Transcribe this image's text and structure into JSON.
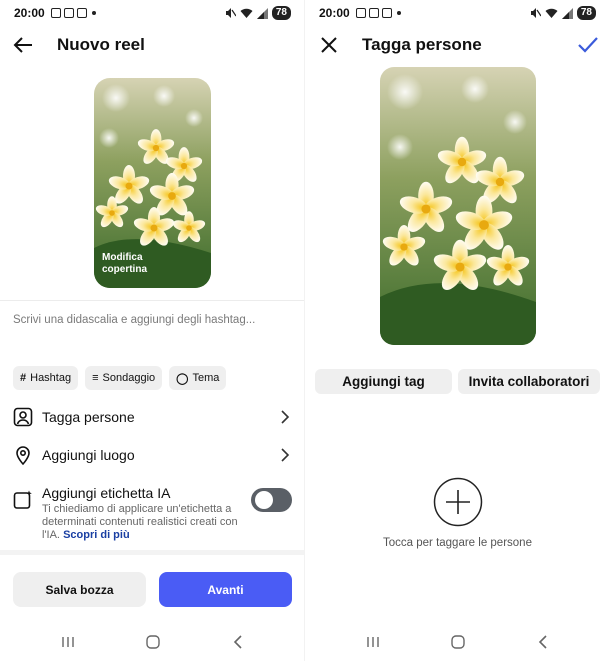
{
  "left": {
    "status": {
      "time": "20:00",
      "battery": "78"
    },
    "header": {
      "title": "Nuovo reel"
    },
    "cover": {
      "label_line1": "Modifica",
      "label_line2": "copertina"
    },
    "caption_placeholder": "Scrivi una didascalia e aggiungi degli hashtag...",
    "chips": [
      {
        "glyph": "#",
        "label": "Hashtag"
      },
      {
        "glyph": "≡",
        "label": "Sondaggio"
      },
      {
        "glyph": "◯",
        "label": "Tema"
      }
    ],
    "rows": {
      "tag_people": "Tagga persone",
      "add_location": "Aggiungi luogo"
    },
    "ai_label": {
      "title": "Aggiungi etichetta IA",
      "description": "Ti chiediamo di applicare un'etichetta a determinati contenuti realistici creati con l'IA.",
      "link": "Scopri di più",
      "toggle_on": false
    },
    "buttons": {
      "save_draft": "Salva bozza",
      "next": "Avanti"
    },
    "colors": {
      "accent": "#4a5cf5",
      "link": "#1a3fa3"
    }
  },
  "right": {
    "status": {
      "time": "20:00",
      "battery": "78"
    },
    "header": {
      "title": "Tagga persone"
    },
    "buttons": {
      "add_tag": "Aggiungi tag",
      "invite_collaborators": "Invita collaboratori"
    },
    "hint": "Tocca per taggare le persone"
  }
}
